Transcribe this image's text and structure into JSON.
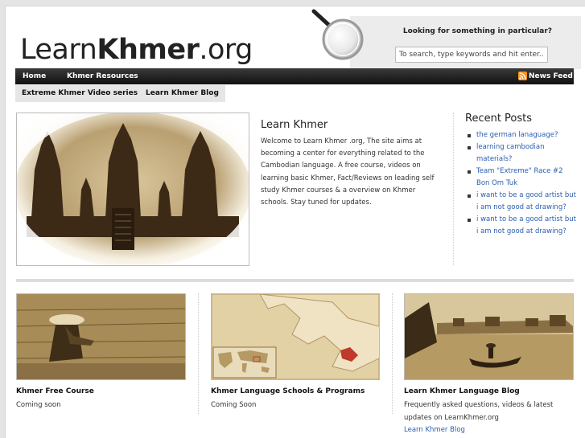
{
  "header": {
    "logo_light": "Learn",
    "logo_bold": "Khmer",
    "logo_suffix": ".org",
    "search_title": "Looking for something in particular?",
    "search_placeholder": "To search, type keywords and hit enter..."
  },
  "nav": {
    "items": [
      "Home",
      "Khmer Resources"
    ],
    "news_feed": "News Feed"
  },
  "subnav": {
    "items": [
      "Extreme Khmer Video series",
      "Learn Khmer Blog"
    ]
  },
  "intro": {
    "title": "Learn Khmer",
    "text": "Welcome to Learn Khmer .org, The site aims at becoming a center for everything related to the Cambodian language. A free course, videos on learning basic Khmer, Fact/Reviews on leading self study Khmer courses & a overview on Khmer schools. Stay tuned for updates."
  },
  "recent": {
    "title": "Recent Posts",
    "posts": [
      "the german lanaguage?",
      "learning cambodian materials?",
      "Team \"Extreme\" Race #2 Bon Om Tuk",
      "i want to be a good artist but i am not good at drawing?",
      "i want to be a good artist but i am not good at drawing?"
    ]
  },
  "cards": [
    {
      "title": "Khmer Free Course",
      "text": "Coming soon"
    },
    {
      "title": "Khmer Language Schools & Programs",
      "text": "Coming Soon"
    },
    {
      "title": "Learn Khmer Language Blog",
      "text": "Frequently asked questions, videos & latest updates on LearnKhmer.org",
      "link": "Learn Khmer Blog"
    }
  ],
  "colors": {
    "link": "#2a5db0",
    "nav_bg": "#111111",
    "rss": "#f7931e",
    "sepia": "#b59a64"
  }
}
